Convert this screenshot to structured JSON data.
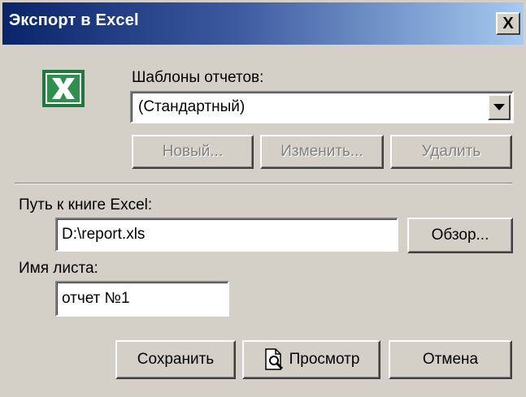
{
  "window": {
    "title": "Экспорт в Excel",
    "close_label": "X"
  },
  "templates": {
    "label": "Шаблоны отчетов:",
    "selected": "(Стандартный)",
    "new_label": "Новый...",
    "edit_label": "Изменить...",
    "delete_label": "Удалить"
  },
  "path": {
    "label": "Путь к книге Excel:",
    "value": "D:\\report.xls",
    "browse_label": "Обзор..."
  },
  "sheet": {
    "label": "Имя листа:",
    "value": "отчет №1"
  },
  "actions": {
    "save_label": "Сохранить",
    "preview_label": "Просмотр",
    "cancel_label": "Отмена"
  },
  "icons": {
    "app_icon": "excel-icon",
    "dropdown_icon": "chevron-down-icon",
    "preview_icon": "document-magnifier-icon"
  },
  "colors": {
    "titlebar_start": "#0a246a",
    "titlebar_end": "#a6caf0",
    "excel_green": "#1e7a3c",
    "dialog_bg": "#d4d0c8"
  }
}
